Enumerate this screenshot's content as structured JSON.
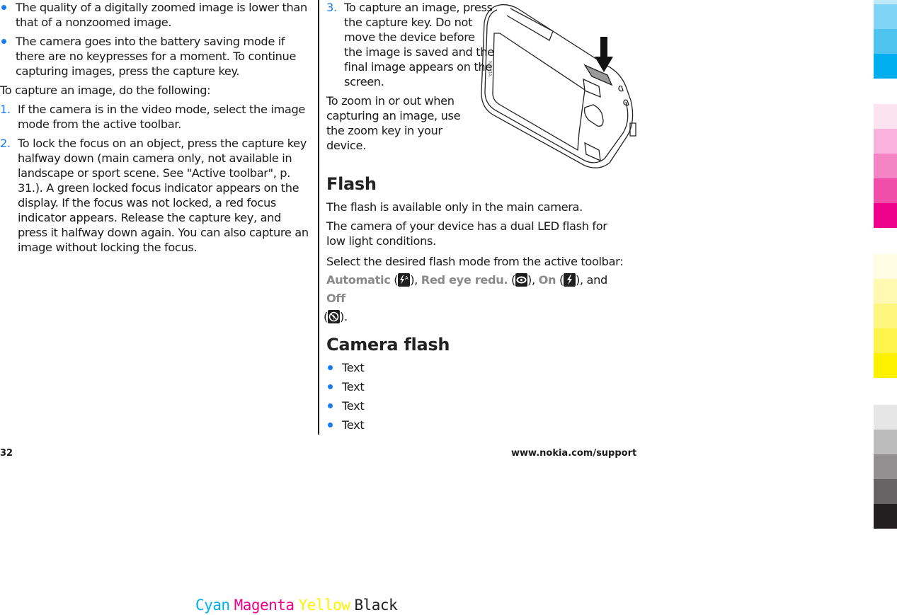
{
  "left_column": {
    "bullets": [
      "The quality of a digitally zoomed image is lower than that of a nonzoomed image.",
      "The camera goes into the battery saving mode if there are no keypresses for a moment. To continue capturing images, press the capture key."
    ],
    "intro": "To capture an image, do the following:",
    "steps": [
      {
        "num": "1.",
        "text": "If the camera is in the video mode, select the image mode from the active toolbar."
      },
      {
        "num": "2.",
        "text": "To lock the focus on an object, press the capture key halfway down (main camera only, not available in landscape or sport scene. See \"Active toolbar\", p. 31.). A green locked focus indicator appears on the display. If the focus was not locked, a red focus indicator appears. Release the capture key, and press it halfway down again. You can also capture an image without locking the focus."
      }
    ]
  },
  "right_column": {
    "step3": {
      "num": "3.",
      "text": "To capture an image, press the capture key. Do not move the device before the image is saved and the final image appears on the screen."
    },
    "zoom_text": "To zoom in or out when capturing an image, use the zoom key in your device.",
    "illustration": "nokia-device-capture-key-illustration",
    "flash": {
      "heading": "Flash",
      "para1": "The flash is available only in the main camera.",
      "para2": "The camera of your device has a dual LED flash for low light conditions.",
      "para3_lead": "Select the desired flash mode from the active toolbar:",
      "modes": [
        {
          "label": "Automatic",
          "icon": "flash-auto-icon"
        },
        {
          "label": "Red eye redu.",
          "icon": "red-eye-icon"
        },
        {
          "label": "On",
          "icon": "flash-on-icon"
        },
        {
          "label": "Off",
          "icon": "flash-off-icon"
        }
      ],
      "sep_comma": ", ",
      "sep_and": ", and ",
      "open_paren": " (",
      "close_paren": ")",
      "end": "."
    },
    "camera_flash": {
      "heading": "Camera flash",
      "items": [
        "Text",
        "Text",
        "Text",
        "Text"
      ]
    }
  },
  "footer": {
    "page_number": "32",
    "url": "www.nokia.com/support"
  },
  "color_bars": {
    "cyan": [
      "#bfe8f8",
      "#80d4f5",
      "#4dc3ee",
      "#00aeef"
    ],
    "magenta": [
      "#fbe3f0",
      "#f9b2dc",
      "#f484c4",
      "#f04ea9",
      "#ec008c"
    ],
    "yellow": [
      "#fffde3",
      "#fff9b1",
      "#fff67f",
      "#fff34c",
      "#fff200"
    ],
    "black": [
      "#e6e6e6",
      "#bcbcbc",
      "#918f90",
      "#666465",
      "#231f20"
    ]
  },
  "separation_labels": [
    {
      "text": "Cyan",
      "color": "#00aeef"
    },
    {
      "text": "Magenta",
      "color": "#ec008c"
    },
    {
      "text": "Yellow",
      "color": "#fff200"
    },
    {
      "text": "Black",
      "color": "#231f20"
    }
  ]
}
